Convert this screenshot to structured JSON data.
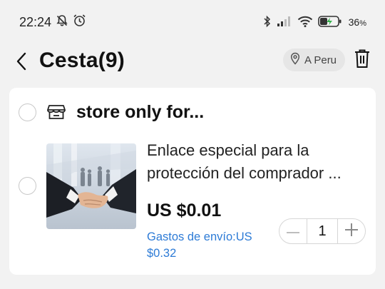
{
  "status_bar": {
    "time": "22:24",
    "battery_percent": "36",
    "battery_unit": "%",
    "icons": [
      "mute-bell-icon",
      "alarm-icon",
      "bluetooth-icon",
      "signal-icon",
      "wifi-icon",
      "battery-charging-icon"
    ]
  },
  "header": {
    "title": "Cesta(9)",
    "ship_to": "A Peru"
  },
  "store": {
    "name": "store only for..."
  },
  "item": {
    "title_line1": "Enlace especial para la",
    "title_line2": "protección del comprador ...",
    "price": "US $0.01",
    "shipping_line1": "Gastos de envío:US",
    "shipping_line2": "$0.32",
    "quantity": "1"
  },
  "colors": {
    "link_blue": "#2d7bd6",
    "background": "#f2f2f2",
    "card": "#ffffff"
  }
}
